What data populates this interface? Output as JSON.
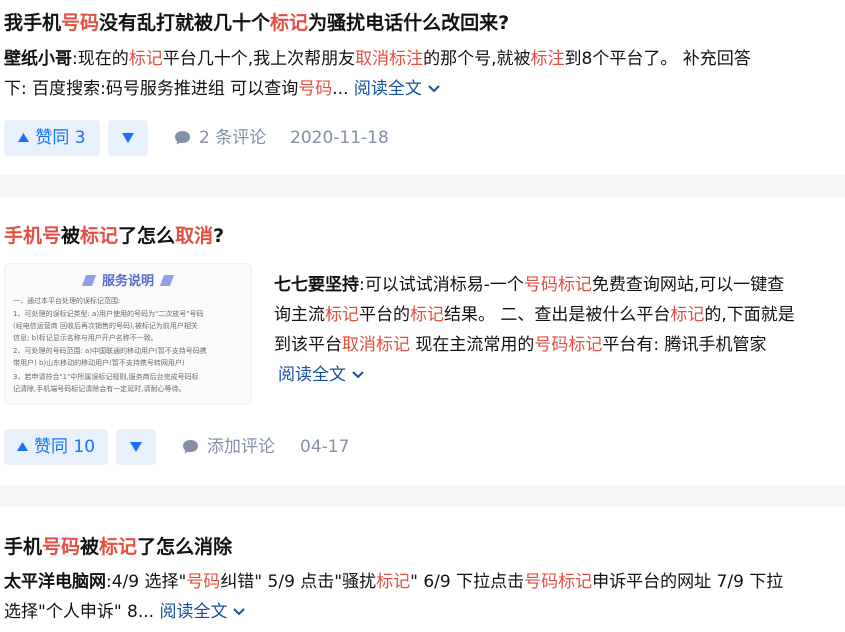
{
  "results": [
    {
      "title": [
        {
          "t": "我手机",
          "h": false
        },
        {
          "t": "号码",
          "h": true
        },
        {
          "t": "没有乱打就被几十个",
          "h": false
        },
        {
          "t": "标记",
          "h": true
        },
        {
          "t": "为骚扰电话什么改回来?",
          "h": false
        }
      ],
      "author": "壁纸小哥",
      "excerpt_line1": [
        {
          "t": ":现在的",
          "h": false
        },
        {
          "t": "标记",
          "h": true
        },
        {
          "t": "平台几十个,我上次帮朋友",
          "h": false
        },
        {
          "t": "取消标注",
          "h": true
        },
        {
          "t": "的那个号,就被",
          "h": false
        },
        {
          "t": "标注",
          "h": true
        },
        {
          "t": "到8个平台了。 补充回答",
          "h": false
        }
      ],
      "excerpt_line2": [
        {
          "t": "下: 百度搜索:码号服务推进组 可以查询",
          "h": false
        },
        {
          "t": "号码",
          "h": true
        },
        {
          "t": "...",
          "h": false
        }
      ],
      "read_more": "阅读全文",
      "upvote_label": "赞同 3",
      "comment_label": "2 条评论",
      "date": "2020-11-18"
    },
    {
      "title": [
        {
          "t": "手机号",
          "h": true
        },
        {
          "t": "被",
          "h": false
        },
        {
          "t": "标记",
          "h": true
        },
        {
          "t": "了怎么",
          "h": false
        },
        {
          "t": "取消",
          "h": true
        },
        {
          "t": "?",
          "h": false
        }
      ],
      "author": "七七要坚持",
      "excerpt_lines": [
        [
          {
            "t": ":可以试试消标易-一个",
            "h": false
          },
          {
            "t": "号码标记",
            "h": true
          },
          {
            "t": "免费查询网站,可以一键查",
            "h": false
          }
        ],
        [
          {
            "t": "询主流",
            "h": false
          },
          {
            "t": "标记",
            "h": true
          },
          {
            "t": "平台的",
            "h": false
          },
          {
            "t": "标记",
            "h": true
          },
          {
            "t": "结果。 二、查出是被什么平台",
            "h": false
          },
          {
            "t": "标记",
            "h": true
          },
          {
            "t": "的,下面就是",
            "h": false
          }
        ],
        [
          {
            "t": "到该平台",
            "h": false
          },
          {
            "t": "取消标记",
            "h": true
          },
          {
            "t": " 现在主流常用的",
            "h": false
          },
          {
            "t": "号码标记",
            "h": true
          },
          {
            "t": "平台有: 腾讯手机管家",
            "h": false
          }
        ]
      ],
      "read_more": "阅读全文",
      "upvote_label": "赞同 10",
      "comment_label": "添加评论",
      "date": "04-17",
      "thumbnail": {
        "title": "服务说明",
        "lines": [
          "一、通过本平台处理的误标记范围:",
          "1、可处理的误标记类型: a)用户使用的号码为\"二次放号\"号码",
          "(经电信运营商 回收后再次销售的号码),被标记为前用户相关",
          "信息; b)标记显示名称与用户开户名称不一致。",
          "2、可处理的号码范围: a)中国联通的移动用户(暂不支持号码携",
          "带用户) b)山东移动的移动用户(暂不支持携号转网用户)",
          "3、若申请符合\"1\"中所属误标记规则,服务商后台完成号码标",
          "记清除,手机端号码标记清除会有一定延时,请耐心等待。"
        ]
      }
    },
    {
      "title": [
        {
          "t": "手机",
          "h": false
        },
        {
          "t": "号码",
          "h": true
        },
        {
          "t": "被",
          "h": false
        },
        {
          "t": "标记",
          "h": true
        },
        {
          "t": "了怎么消除",
          "h": false
        }
      ],
      "author": "太平洋电脑网",
      "excerpt_line1": [
        {
          "t": ":4/9 选择\"",
          "h": false
        },
        {
          "t": "号码",
          "h": true
        },
        {
          "t": "纠错\" 5/9 点击\"骚扰",
          "h": false
        },
        {
          "t": "标记",
          "h": true
        },
        {
          "t": "\" 6/9 下拉点击",
          "h": false
        },
        {
          "t": "号码标记",
          "h": true
        },
        {
          "t": "申诉平台的网址 7/9 下拉",
          "h": false
        }
      ],
      "excerpt_line2": [
        {
          "t": "选择\"个人申诉\" 8...",
          "h": false
        }
      ],
      "read_more": "阅读全文"
    }
  ],
  "colors": {
    "highlight": "#e24f43",
    "link": "#175199",
    "vote": "#1772f6",
    "vote_bg": "#e8f0fc",
    "meta": "#8590a6",
    "separator": "#f6f6f6"
  }
}
